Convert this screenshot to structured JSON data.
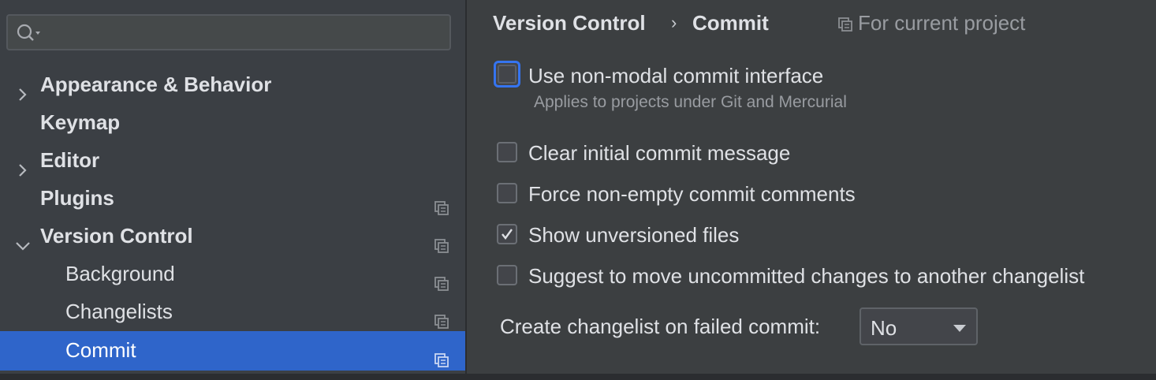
{
  "search": {
    "placeholder": "",
    "value": ""
  },
  "tree": [
    {
      "label": "Appearance & Behavior",
      "expandable": true,
      "expanded": false,
      "project": false
    },
    {
      "label": "Keymap",
      "expandable": false,
      "project": false
    },
    {
      "label": "Editor",
      "expandable": true,
      "expanded": false,
      "project": false
    },
    {
      "label": "Plugins",
      "expandable": false,
      "project": true
    },
    {
      "label": "Version Control",
      "expandable": true,
      "expanded": true,
      "project": true
    },
    {
      "label": "Background",
      "expandable": false,
      "project": true
    },
    {
      "label": "Changelists",
      "expandable": false,
      "project": true
    },
    {
      "label": "Commit",
      "expandable": false,
      "project": true,
      "selected": true
    }
  ],
  "breadcrumb": {
    "parent": "Version Control",
    "separator": "›",
    "current": "Commit",
    "scope_label": "For current project"
  },
  "options": {
    "non_modal": {
      "label": "Use non-modal commit interface",
      "hint": "Applies to projects under Git and Mercurial",
      "checked": false
    },
    "clear_message": {
      "label": "Clear initial commit message",
      "checked": false
    },
    "force_comments": {
      "label": "Force non-empty commit comments",
      "checked": false
    },
    "show_unversioned": {
      "label": "Show unversioned files",
      "checked": true
    },
    "suggest_move": {
      "label": "Suggest to move uncommitted changes to another changelist",
      "checked": false
    }
  },
  "changelist_on_fail": {
    "label": "Create changelist on failed commit:",
    "value": "No"
  },
  "icons": {
    "search": "search-icon",
    "expand": "chevron-right-icon",
    "collapse": "chevron-down-icon",
    "project": "project-scope-icon",
    "check": "checkmark-icon",
    "dropdown": "dropdown-arrow-icon"
  },
  "colors": {
    "sidebar_bg": "#3b3f44",
    "main_bg": "#3c3f41",
    "selection": "#2f65ca",
    "focus": "#3574f0"
  }
}
